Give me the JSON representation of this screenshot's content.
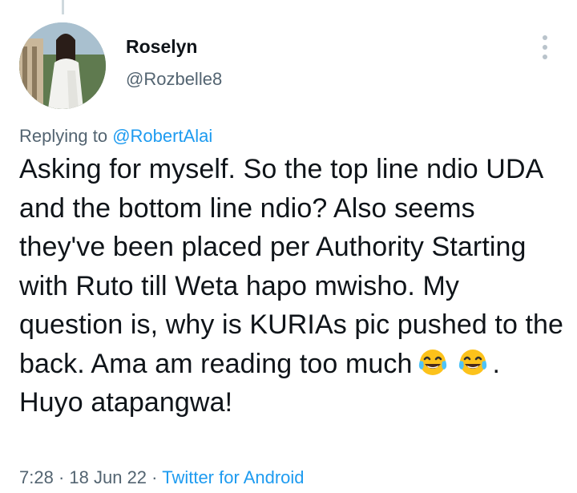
{
  "author": {
    "display_name": "Roselyn",
    "handle": "@Rozbelle8"
  },
  "reply": {
    "prefix": "Replying to",
    "target": "@RobertAlai"
  },
  "tweet": {
    "text_part1": "Asking for myself. So the top line ndio UDA and the bottom line ndio? Also seems they've been placed per Authority Starting with Ruto till Weta hapo mwisho. My question is, why is KURIAs pic pushed to the back. Ama am reading too much",
    "emoji_1": "face-with-tears-of-joy",
    "emoji_2": "face-with-tears-of-joy",
    "text_part2": ". Huyo atapangwa!"
  },
  "meta": {
    "time": "7:28",
    "separator": "·",
    "date": "18 Jun 22",
    "source": "Twitter for Android"
  },
  "colors": {
    "text": "#0f1419",
    "secondary": "#536471",
    "link": "#1d9bf0"
  }
}
